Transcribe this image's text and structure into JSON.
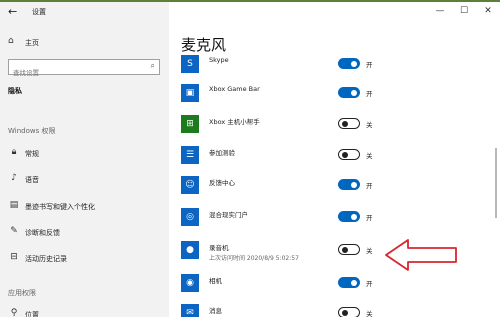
{
  "window": {
    "back_glyph": "←",
    "title": "设置",
    "controls": {
      "minimize": "—",
      "maximize": "☐",
      "close": "✕"
    }
  },
  "sidebar": {
    "home_label": "主页",
    "search_placeholder": "查找设置",
    "privacy_heading": "隐私",
    "windows_permissions_heading": "Windows 权限",
    "windows_items": [
      {
        "label": "常规",
        "icon": "lock-icon"
      },
      {
        "label": "语音",
        "icon": "speech-icon"
      },
      {
        "label": "墨迹书写和键入个性化",
        "icon": "pen-keyboard-icon"
      },
      {
        "label": "诊断和反馈",
        "icon": "feedback-icon"
      },
      {
        "label": "活动历史记录",
        "icon": "timeline-icon"
      }
    ],
    "app_permissions_heading": "应用权限",
    "app_items": [
      {
        "label": "位置",
        "icon": "location-icon"
      }
    ]
  },
  "main": {
    "title": "麦克风",
    "apps": [
      {
        "name": "Skype",
        "state": "on",
        "state_label": "开",
        "icon": "skype-icon"
      },
      {
        "name": "Xbox Game Bar",
        "state": "on",
        "state_label": "开",
        "icon": "xbox-game-bar-icon"
      },
      {
        "name": "Xbox 主机小帮手",
        "state": "off",
        "state_label": "关",
        "icon": "xbox-console-icon"
      },
      {
        "name": "参加测验",
        "state": "off",
        "state_label": "关",
        "icon": "test-icon"
      },
      {
        "name": "反馈中心",
        "state": "on",
        "state_label": "开",
        "icon": "feedback-hub-icon"
      },
      {
        "name": "混合现实门户",
        "state": "on",
        "state_label": "开",
        "icon": "mixed-reality-icon"
      },
      {
        "name": "录音机",
        "sub": "上次访问时间 2020/8/9 5:02:57",
        "state": "off",
        "state_label": "关",
        "icon": "voice-recorder-icon"
      },
      {
        "name": "相机",
        "state": "on",
        "state_label": "开",
        "icon": "camera-icon"
      },
      {
        "name": "消息",
        "state": "off",
        "state_label": "关",
        "icon": "messaging-icon"
      }
    ]
  },
  "colors": {
    "accent": "#0067c0",
    "sidebar_bg": "#f2f2f2",
    "annotation_arrow": "#d9262c"
  }
}
